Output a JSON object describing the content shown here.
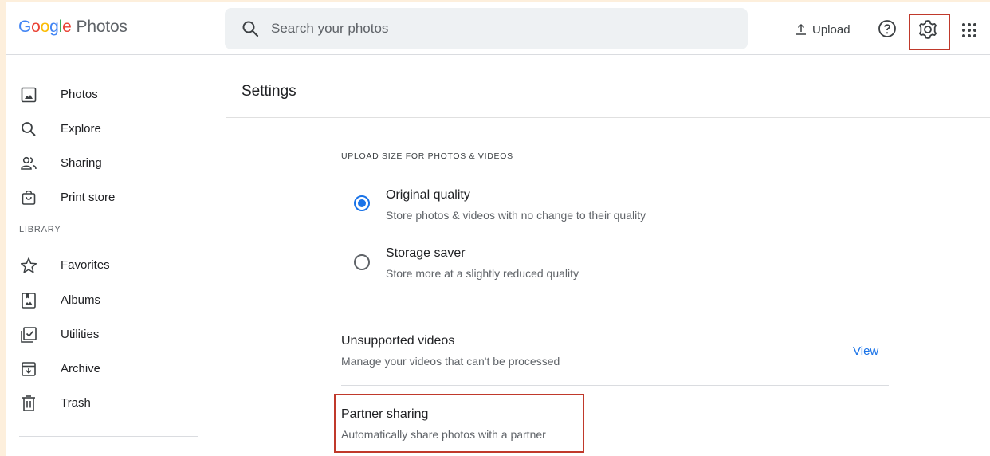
{
  "header": {
    "logo_google": "Google",
    "logo_product": "Photos",
    "search_placeholder": "Search your photos",
    "upload_label": "Upload"
  },
  "sidebar": {
    "items": [
      {
        "label": "Photos",
        "icon": "photo-icon"
      },
      {
        "label": "Explore",
        "icon": "search-icon"
      },
      {
        "label": "Sharing",
        "icon": "people-icon"
      },
      {
        "label": "Print store",
        "icon": "shopping-bag-icon"
      }
    ],
    "library_label": "LIBRARY",
    "library_items": [
      {
        "label": "Favorites",
        "icon": "star-icon"
      },
      {
        "label": "Albums",
        "icon": "album-icon"
      },
      {
        "label": "Utilities",
        "icon": "checklist-icon"
      },
      {
        "label": "Archive",
        "icon": "archive-icon"
      },
      {
        "label": "Trash",
        "icon": "trash-icon"
      }
    ]
  },
  "settings": {
    "title": "Settings",
    "upload_size_label": "UPLOAD SIZE FOR PHOTOS & VIDEOS",
    "options": [
      {
        "title": "Original quality",
        "subtitle": "Store photos & videos with no change to their quality",
        "selected": true
      },
      {
        "title": "Storage saver",
        "subtitle": "Store more at a slightly reduced quality",
        "selected": false
      }
    ],
    "unsupported": {
      "title": "Unsupported videos",
      "subtitle": "Manage your videos that can't be processed",
      "action": "View"
    },
    "partner": {
      "title": "Partner sharing",
      "subtitle": "Automatically share photos with a partner"
    }
  },
  "colors": {
    "accent": "#1a73e8",
    "highlight_box": "#c0392b",
    "background_frame": "#fdefdc"
  }
}
